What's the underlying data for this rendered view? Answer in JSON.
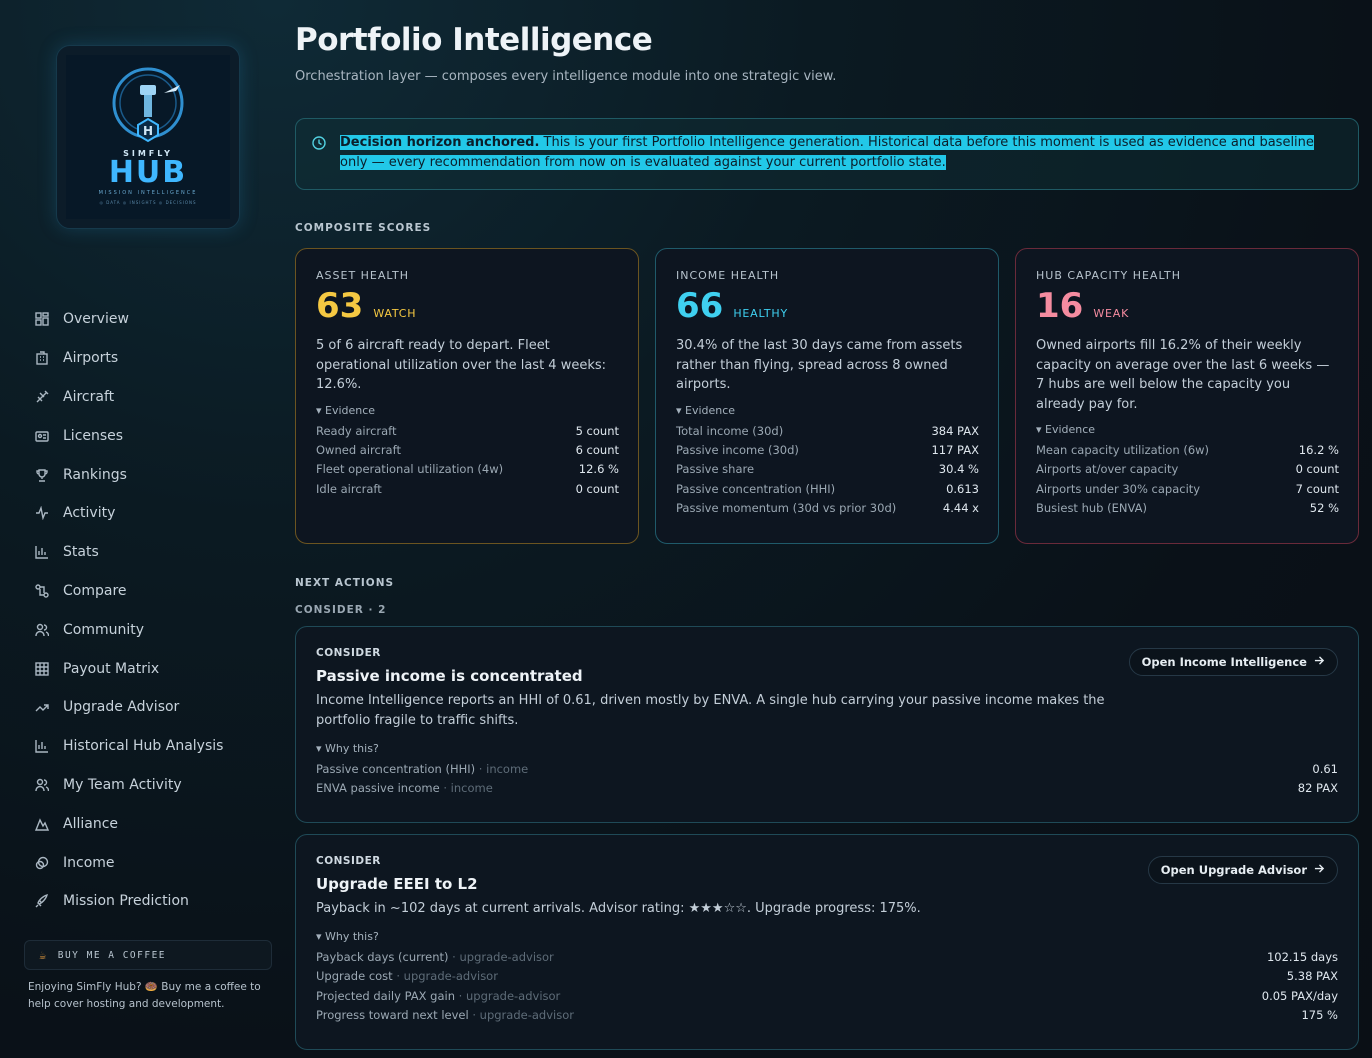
{
  "logo": {
    "brand_top": "SIMFLY",
    "brand_main": "HUB",
    "tagline": "MISSION INTELLIGENCE",
    "mini": "◎ DATA   ◎ INSIGHTS   ◎ DECISIONS"
  },
  "sidebar": {
    "items": [
      {
        "label": "Overview",
        "icon": "grid-icon"
      },
      {
        "label": "Airports",
        "icon": "building-icon"
      },
      {
        "label": "Aircraft",
        "icon": "plane-icon"
      },
      {
        "label": "Licenses",
        "icon": "id-card-icon"
      },
      {
        "label": "Rankings",
        "icon": "trophy-icon"
      },
      {
        "label": "Activity",
        "icon": "pulse-icon"
      },
      {
        "label": "Stats",
        "icon": "bar-chart-icon"
      },
      {
        "label": "Compare",
        "icon": "compare-icon"
      },
      {
        "label": "Community",
        "icon": "users-icon"
      },
      {
        "label": "Payout Matrix",
        "icon": "table-icon"
      },
      {
        "label": "Upgrade Advisor",
        "icon": "trend-up-icon"
      },
      {
        "label": "Historical Hub Analysis",
        "icon": "bar-chart-icon"
      },
      {
        "label": "My Team Activity",
        "icon": "users-icon"
      },
      {
        "label": "Alliance",
        "icon": "mountain-icon"
      },
      {
        "label": "Income",
        "icon": "coins-icon"
      },
      {
        "label": "Mission Prediction",
        "icon": "rocket-icon"
      }
    ],
    "coffee_label": "BUY ME A COFFEE",
    "coffee_note": "Enjoying SimFly Hub? 🍩 Buy me a coffee to help cover hosting and development."
  },
  "header": {
    "title": "Portfolio Intelligence",
    "subtitle": "Orchestration layer — composes every intelligence module into one strategic view."
  },
  "banner": {
    "bold": "Decision horizon anchored.",
    "text": " This is your first Portfolio Intelligence generation. Historical data before this moment is used as evidence and baseline only — every recommendation from now on is evaluated against your current portfolio state."
  },
  "composite": {
    "label": "COMPOSITE SCORES",
    "cards": [
      {
        "title": "ASSET HEALTH",
        "score": "63",
        "status": "WATCH",
        "color": "#f5c842",
        "border": "#6b5420",
        "desc": "5 of 6 aircraft ready to depart. Fleet operational utilization over the last 4 weeks: 12.6%.",
        "evidence_label": "▾ Evidence",
        "evidence": [
          {
            "k": "Ready aircraft",
            "v": "5 count"
          },
          {
            "k": "Owned aircraft",
            "v": "6 count"
          },
          {
            "k": "Fleet operational utilization (4w)",
            "v": "12.6 %"
          },
          {
            "k": "Idle aircraft",
            "v": "0 count"
          }
        ]
      },
      {
        "title": "INCOME HEALTH",
        "score": "66",
        "status": "HEALTHY",
        "color": "#3fd0f0",
        "border": "#1f5a6a",
        "desc": "30.4% of the last 30 days came from assets rather than flying, spread across 8 owned airports.",
        "evidence_label": "▾ Evidence",
        "evidence": [
          {
            "k": "Total income (30d)",
            "v": "384 PAX"
          },
          {
            "k": "Passive income (30d)",
            "v": "117 PAX"
          },
          {
            "k": "Passive share",
            "v": "30.4 %"
          },
          {
            "k": "Passive concentration (HHI)",
            "v": "0.613"
          },
          {
            "k": "Passive momentum (30d vs prior 30d)",
            "v": "4.44 x"
          }
        ]
      },
      {
        "title": "HUB CAPACITY HEALTH",
        "score": "16",
        "status": "WEAK",
        "color": "#f58ca0",
        "border": "#6a2a3a",
        "desc": "Owned airports fill 16.2% of their weekly capacity on average over the last 6 weeks — 7 hubs are well below the capacity you already pay for.",
        "evidence_label": "▾ Evidence",
        "evidence": [
          {
            "k": "Mean capacity utilization (6w)",
            "v": "16.2 %"
          },
          {
            "k": "Airports at/over capacity",
            "v": "0 count"
          },
          {
            "k": "Airports under 30% capacity",
            "v": "7 count"
          },
          {
            "k": "Busiest hub (ENVA)",
            "v": "52 %"
          }
        ]
      }
    ]
  },
  "next_actions": {
    "label": "NEXT ACTIONS",
    "group_label": "CONSIDER · 2",
    "items": [
      {
        "kind": "CONSIDER",
        "title": "Passive income is concentrated",
        "desc": "Income Intelligence reports an HHI of 0.61, driven mostly by ENVA. A single hub carrying your passive income makes the portfolio fragile to traffic shifts.",
        "button": "Open Income Intelligence",
        "why_label": "▾ Why this?",
        "evidence": [
          {
            "k": "Passive concentration (HHI)",
            "src": " · income",
            "v": "0.61"
          },
          {
            "k": "ENVA passive income",
            "src": " · income",
            "v": "82 PAX"
          }
        ]
      },
      {
        "kind": "CONSIDER",
        "title": "Upgrade EEEI to L2",
        "desc": "Payback in ~102 days at current arrivals. Advisor rating: ★★★☆☆. Upgrade progress: 175%.",
        "button": "Open Upgrade Advisor",
        "why_label": "▾ Why this?",
        "evidence": [
          {
            "k": "Payback days (current)",
            "src": " · upgrade-advisor",
            "v": "102.15 days"
          },
          {
            "k": "Upgrade cost",
            "src": " · upgrade-advisor",
            "v": "5.38 PAX"
          },
          {
            "k": "Projected daily PAX gain",
            "src": " · upgrade-advisor",
            "v": "0.05 PAX/day"
          },
          {
            "k": "Progress toward next level",
            "src": " · upgrade-advisor",
            "v": "175 %"
          }
        ]
      }
    ]
  }
}
